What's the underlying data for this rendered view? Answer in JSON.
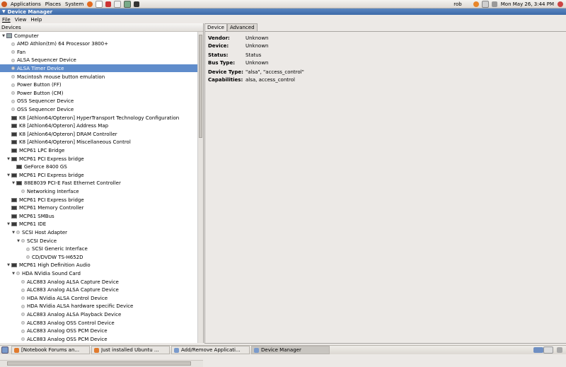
{
  "topbar": {
    "menus": [
      "Applications",
      "Places",
      "System"
    ],
    "user": "rob",
    "clock": "Mon May 26,  3:44 PM"
  },
  "window": {
    "title": "Device Manager"
  },
  "menubar": [
    "File",
    "View",
    "Help"
  ],
  "left": {
    "header": "Devices"
  },
  "tree": [
    {
      "label": "Computer",
      "indent": 0,
      "exp": "down",
      "icon": "pc"
    },
    {
      "label": "AMD Athlon(tm) 64 Processor 3800+",
      "indent": 1,
      "exp": "",
      "icon": "disc"
    },
    {
      "label": "Fan",
      "indent": 1,
      "exp": "",
      "icon": "disc"
    },
    {
      "label": "ALSA Sequencer Device",
      "indent": 1,
      "exp": "",
      "icon": "disc"
    },
    {
      "label": "ALSA Timer Device",
      "indent": 1,
      "exp": "",
      "icon": "disc",
      "selected": true
    },
    {
      "label": "Macintosh mouse button emulation",
      "indent": 1,
      "exp": "",
      "icon": "disc"
    },
    {
      "label": "Power Button (FF)",
      "indent": 1,
      "exp": "",
      "icon": "disc"
    },
    {
      "label": "Power Button (CM)",
      "indent": 1,
      "exp": "",
      "icon": "disc"
    },
    {
      "label": "OSS Sequencer Device",
      "indent": 1,
      "exp": "",
      "icon": "disc"
    },
    {
      "label": "OSS Sequencer Device",
      "indent": 1,
      "exp": "",
      "icon": "disc"
    },
    {
      "label": "K8 [Athlon64/Opteron] HyperTransport Technology Configuration",
      "indent": 1,
      "exp": "",
      "icon": "chip"
    },
    {
      "label": "K8 [Athlon64/Opteron] Address Map",
      "indent": 1,
      "exp": "",
      "icon": "chip"
    },
    {
      "label": "K8 [Athlon64/Opteron] DRAM Controller",
      "indent": 1,
      "exp": "",
      "icon": "chip"
    },
    {
      "label": "K8 [Athlon64/Opteron] Miscellaneous Control",
      "indent": 1,
      "exp": "",
      "icon": "chip"
    },
    {
      "label": "MCP61 LPC Bridge",
      "indent": 1,
      "exp": "",
      "icon": "chip"
    },
    {
      "label": "MCP61 PCI Express bridge",
      "indent": 1,
      "exp": "down",
      "icon": "chip"
    },
    {
      "label": "GeForce 8400 GS",
      "indent": 2,
      "exp": "",
      "icon": "chip"
    },
    {
      "label": "MCP61 PCI Express bridge",
      "indent": 1,
      "exp": "down",
      "icon": "chip"
    },
    {
      "label": "88E8039 PCI-E Fast Ethernet Controller",
      "indent": 2,
      "exp": "down",
      "icon": "chip"
    },
    {
      "label": "Networking Interface",
      "indent": 3,
      "exp": "",
      "icon": "disc"
    },
    {
      "label": "MCP61 PCI Express bridge",
      "indent": 1,
      "exp": "",
      "icon": "chip"
    },
    {
      "label": "MCP61 Memory Controller",
      "indent": 1,
      "exp": "",
      "icon": "chip"
    },
    {
      "label": "MCP61 SMBus",
      "indent": 1,
      "exp": "",
      "icon": "chip"
    },
    {
      "label": "MCP61 IDE",
      "indent": 1,
      "exp": "down",
      "icon": "chip"
    },
    {
      "label": "SCSI Host Adapter",
      "indent": 2,
      "exp": "down",
      "icon": "disc"
    },
    {
      "label": "SCSI Device",
      "indent": 3,
      "exp": "down",
      "icon": "disc"
    },
    {
      "label": "SCSI Generic Interface",
      "indent": 4,
      "exp": "",
      "icon": "disc"
    },
    {
      "label": "CD/DVDW TS-H652D",
      "indent": 4,
      "exp": "",
      "icon": "disc"
    },
    {
      "label": "MCP61 High Definition Audio",
      "indent": 1,
      "exp": "down",
      "icon": "chip"
    },
    {
      "label": "HDA NVidia Sound Card",
      "indent": 2,
      "exp": "down",
      "icon": "disc"
    },
    {
      "label": "ALC883 Analog ALSA Capture Device",
      "indent": 3,
      "exp": "",
      "icon": "disc"
    },
    {
      "label": "ALC883 Analog ALSA Capture Device",
      "indent": 3,
      "exp": "",
      "icon": "disc"
    },
    {
      "label": "HDA NVidia ALSA Control Device",
      "indent": 3,
      "exp": "",
      "icon": "disc"
    },
    {
      "label": "HDA NVidia ALSA hardware specific Device",
      "indent": 3,
      "exp": "",
      "icon": "disc"
    },
    {
      "label": "ALC883 Analog ALSA Playback Device",
      "indent": 3,
      "exp": "",
      "icon": "disc"
    },
    {
      "label": "ALC883 Analog OSS Control Device",
      "indent": 3,
      "exp": "",
      "icon": "disc"
    },
    {
      "label": "ALC883 Analog OSS PCM Device",
      "indent": 3,
      "exp": "",
      "icon": "disc"
    },
    {
      "label": "ALC883 Analog OSS PCM Device",
      "indent": 3,
      "exp": "",
      "icon": "disc"
    }
  ],
  "right": {
    "tabs": [
      "Device",
      "Advanced"
    ],
    "props": [
      {
        "k": "Vendor:",
        "v": "Unknown"
      },
      {
        "k": "Device:",
        "v": "Unknown"
      },
      {
        "k": "Status:",
        "v": "Status"
      },
      {
        "k": "Bus Type:",
        "v": "Unknown"
      },
      {
        "k": "Device Type:",
        "v": "\"alsa\", \"access_control\""
      },
      {
        "k": "Capabilities:",
        "v": "alsa, access_control"
      }
    ]
  },
  "taskbar": [
    {
      "label": "[Notebook Forums an...",
      "color": "#e07a2e"
    },
    {
      "label": "Just installed Ubuntu ...",
      "color": "#e07a2e"
    },
    {
      "label": "Add/Remove Applicati...",
      "color": "#7a9acb"
    },
    {
      "label": "Device Manager",
      "color": "#7a9acb",
      "active": true
    }
  ]
}
